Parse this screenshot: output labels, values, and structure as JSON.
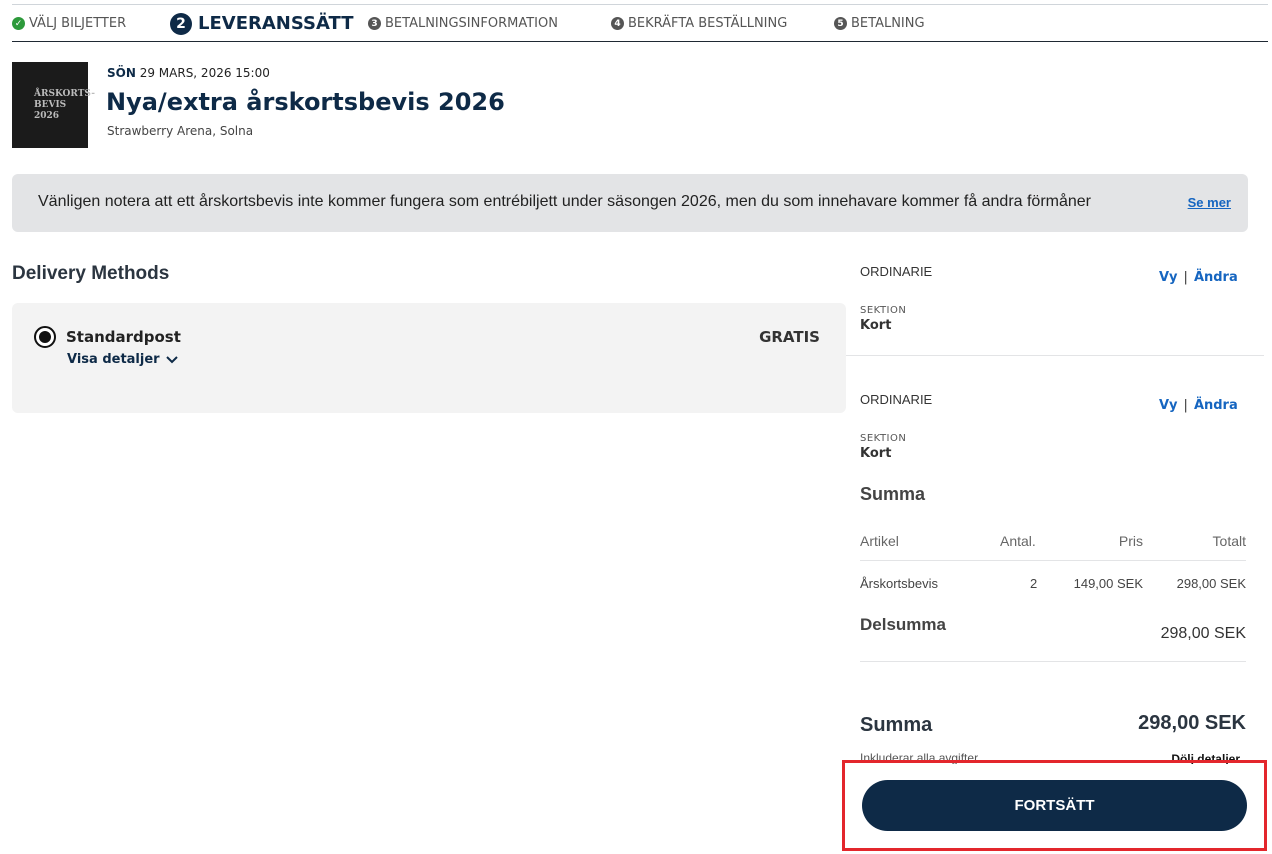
{
  "steps": [
    {
      "label": "VÄLJ BILJETTER",
      "state": "done",
      "icon": "check-icon"
    },
    {
      "label": "LEVERANSSÄTT",
      "num": "2",
      "state": "active"
    },
    {
      "label": "BETALNINGSINFORMATION",
      "num": "3",
      "state": "upcoming"
    },
    {
      "label": "BEKRÄFTA BESTÄLLNING",
      "num": "4",
      "state": "upcoming"
    },
    {
      "label": "BETALNING",
      "num": "5",
      "state": "upcoming"
    }
  ],
  "event": {
    "thumb_line1": "ÅRSKORTS-",
    "thumb_line2": "BEVIS 2026",
    "day": "SÖN",
    "date": " 29 MARS, 2026 15:00",
    "title": "Nya/extra årskortsbevis 2026",
    "venue": "Strawberry Arena, Solna"
  },
  "notice": {
    "text": "Vänligen notera att ett årskortsbevis inte kommer fungera som entrébiljett under säsongen 2026, men du som innehavare kommer få andra förmåner",
    "link": "Se mer"
  },
  "delivery": {
    "heading": "Delivery Methods",
    "option_name": "Standardpost",
    "details_link": "Visa detaljer",
    "price": "GRATIS"
  },
  "tickets": [
    {
      "type": "ORDINARIE",
      "view": "Vy",
      "sep": "|",
      "edit": "Ändra",
      "section_label": "SEKTION",
      "section_value": "Kort"
    },
    {
      "type": "ORDINARIE",
      "view": "Vy",
      "sep": "|",
      "edit": "Ändra",
      "section_label": "SEKTION",
      "section_value": "Kort"
    }
  ],
  "summary": {
    "heading": "Summa",
    "columns": [
      "Artikel",
      "Antal.",
      "Pris",
      "Totalt"
    ],
    "rows": [
      {
        "item": "Årskortsbevis",
        "qty": "2",
        "price": "149,00 SEK",
        "total": "298,00 SEK"
      }
    ],
    "subtotal_label": "Delsumma",
    "subtotal_value": "298,00 SEK",
    "total_label": "Summa",
    "total_value": "298,00 SEK",
    "incl_text": "Inkluderar alla avgifter",
    "hide_details": "Dölj detaljer"
  },
  "continue_button": "FORTSÄTT",
  "colors": {
    "brand": "#0e2a47",
    "link": "#1565c0",
    "highlight": "#e3262c",
    "done": "#2d9a3b"
  }
}
